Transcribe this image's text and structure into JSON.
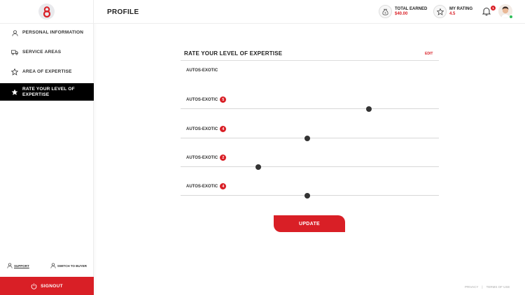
{
  "sidebar": {
    "items": [
      {
        "label": "PERSONAL INFORMATION",
        "icon": "user-icon"
      },
      {
        "label": "SERVICE AREAS",
        "icon": "truck-icon"
      },
      {
        "label": "AREA OF EXPERTISE",
        "icon": "star-outline-icon"
      },
      {
        "label": "RATE YOUR LEVEL OF EXPERTISE",
        "icon": "star-filled-icon",
        "active": true
      }
    ],
    "support_label": "SUPPORT",
    "switch_label": "SWITCH TO BUYER",
    "signout_label": "SIGNOUT"
  },
  "header": {
    "title": "PROFILE",
    "total_earned_label": "TOTAL EARNED",
    "total_earned_value": "$40.00",
    "rating_label": "MY RATING",
    "rating_value": "4.5",
    "notification_count": "1"
  },
  "main": {
    "section_title": "RATE YOUR LEVEL OF EXPERTISE",
    "edit_label": "EDIT",
    "first_category": "AUTOS-EXOTIC",
    "ratings": [
      {
        "label": "AUTOS-EXOTIC",
        "value": "5",
        "level": 0.73
      },
      {
        "label": "AUTOS-EXOTIC",
        "value": "4",
        "level": 0.49
      },
      {
        "label": "AUTOS-EXOTIC",
        "value": "2",
        "level": 0.3
      },
      {
        "label": "AUTOS-EXOTIC",
        "value": "4",
        "level": 0.49
      }
    ],
    "update_label": "UPDATE"
  },
  "footer": {
    "privacy_label": "PRIVACY",
    "separator": "|",
    "terms_label": "TERMS OF USE"
  },
  "colors": {
    "accent": "#d91f26",
    "active_nav_bg": "#000000",
    "online": "#2ebd59"
  }
}
